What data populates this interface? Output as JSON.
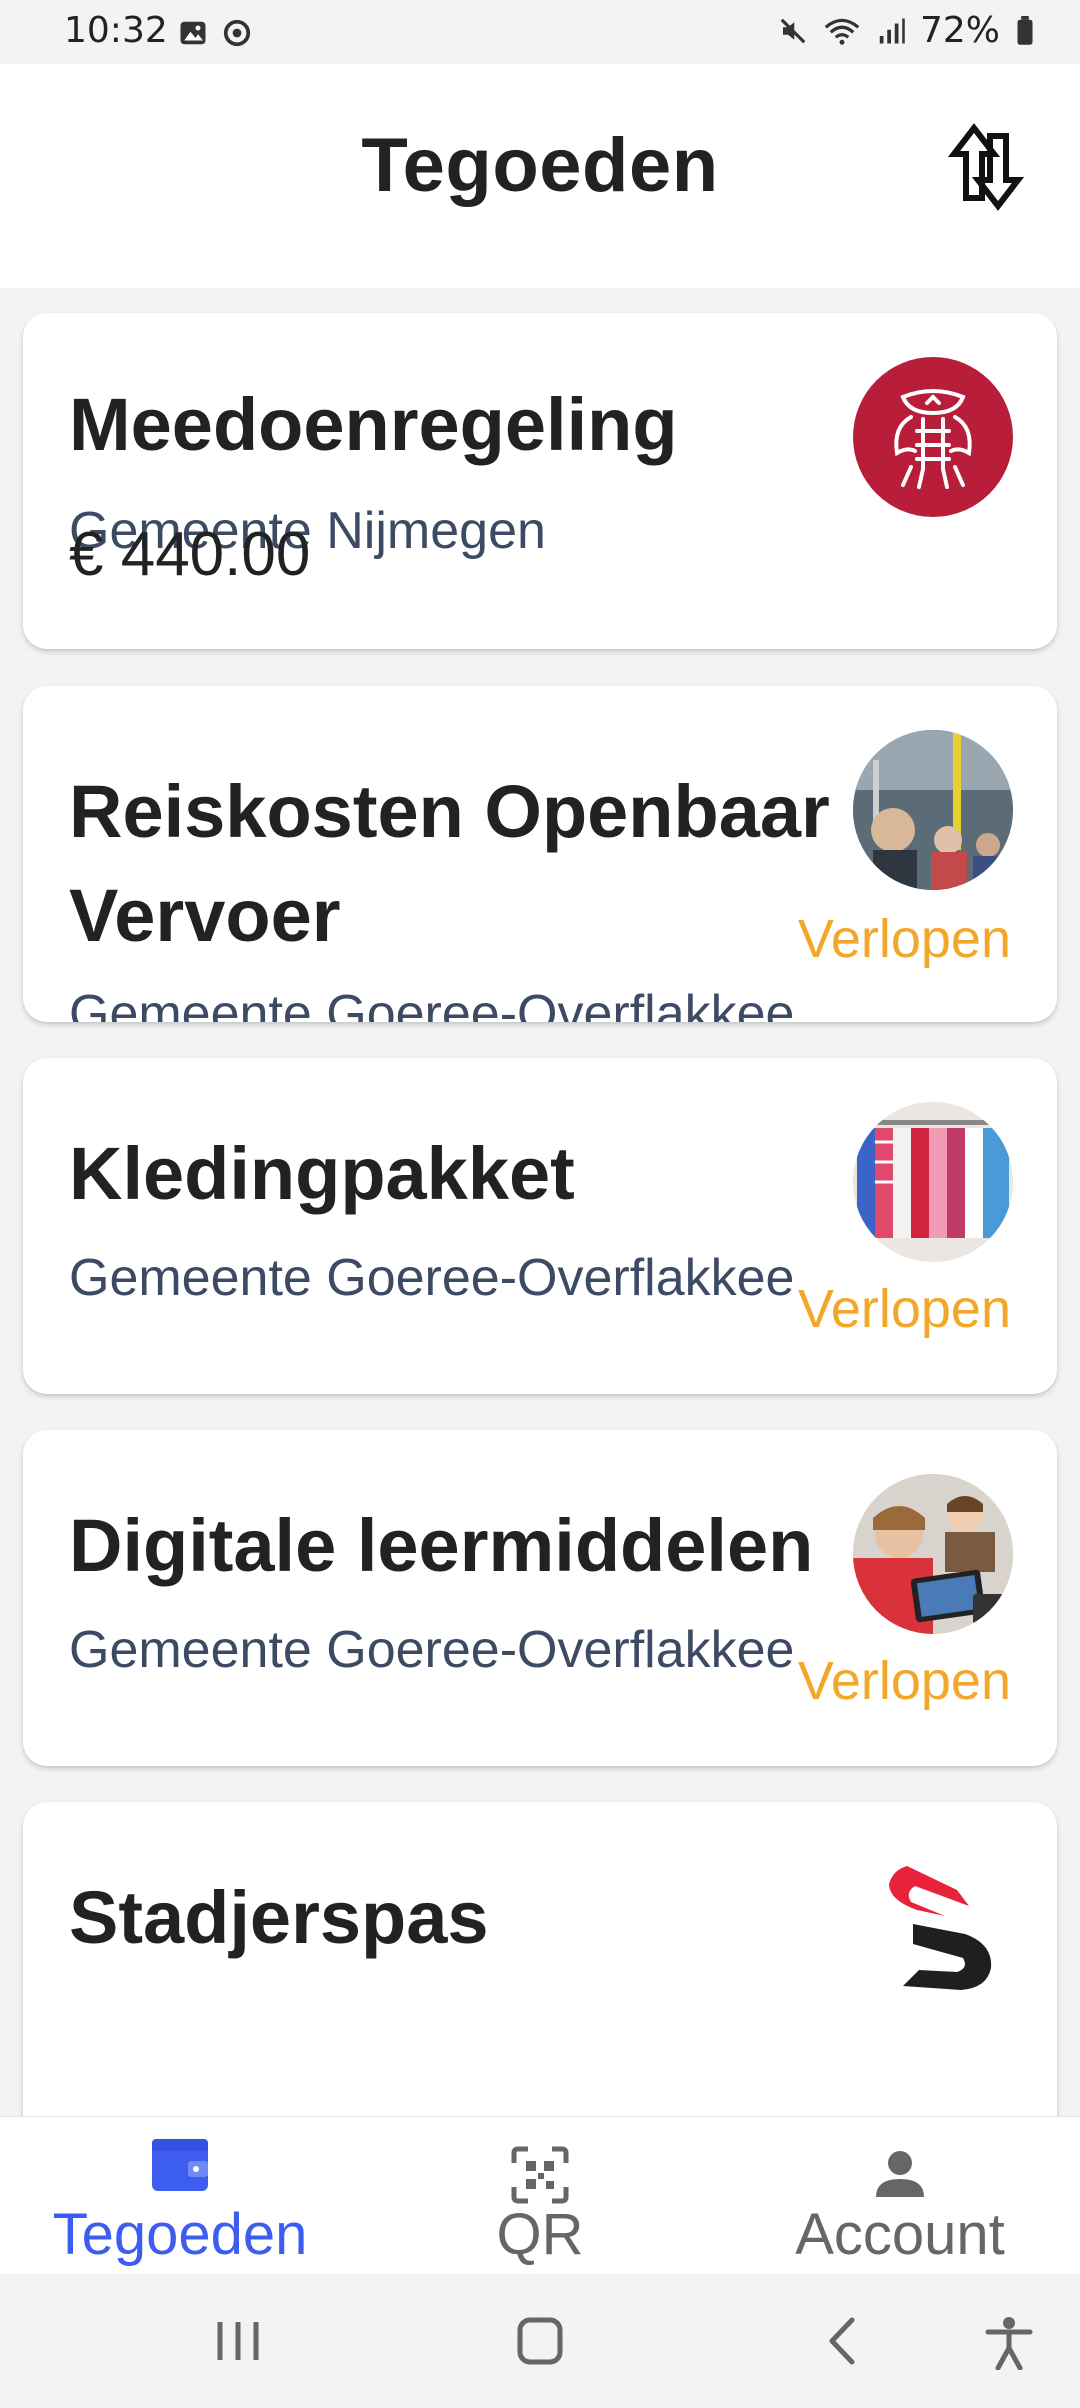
{
  "status_bar": {
    "time": "10:32",
    "battery": "72%"
  },
  "header": {
    "title": "Tegoeden",
    "sort_icon": "sort-arrows-icon"
  },
  "cards": [
    {
      "title": "Meedoenregeling",
      "subtitle": "Gemeente Nijmegen",
      "amount": "€ 440.00",
      "status": "",
      "logo": "gemeente-nijmegen-logo"
    },
    {
      "title": "Reiskosten Openbaar Vervoer",
      "subtitle": "Gemeente Goeree-Overflakkee",
      "amount": "",
      "status": "Verlopen",
      "logo": "public-transport-photo"
    },
    {
      "title": "Kledingpakket",
      "subtitle": "Gemeente Goeree-Overflakkee",
      "amount": "",
      "status": "Verlopen",
      "logo": "clothing-rack-photo"
    },
    {
      "title": "Digitale leermiddelen",
      "subtitle": "Gemeente Goeree-Overflakkee",
      "amount": "",
      "status": "Verlopen",
      "logo": "children-tablets-photo"
    },
    {
      "title": "Stadjerspas",
      "subtitle": "",
      "amount": "",
      "status": "",
      "logo": "stadjerspas-logo"
    }
  ],
  "bottom_nav": {
    "items": [
      {
        "label": "Tegoeden",
        "icon": "wallet-icon",
        "active": true
      },
      {
        "label": "QR",
        "icon": "qr-scan-icon",
        "active": false
      },
      {
        "label": "Account",
        "icon": "person-icon",
        "active": false
      }
    ]
  },
  "colors": {
    "accent": "#3d5df0",
    "status_expired": "#f2a72a",
    "subtitle": "#3d4a64",
    "nijmegen_red": "#b81d3a",
    "stadjerspas_red": "#e8223a"
  }
}
